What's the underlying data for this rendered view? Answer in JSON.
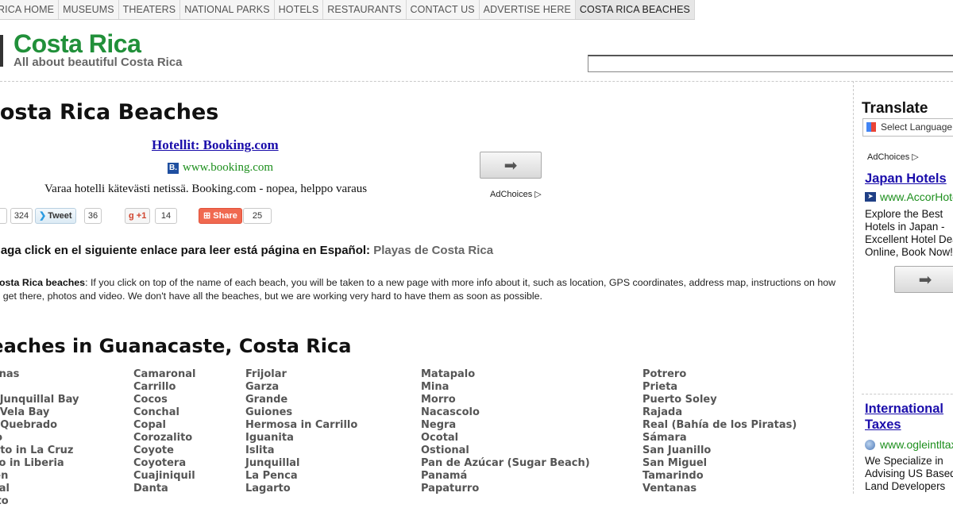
{
  "nav": {
    "items": [
      {
        "label": "RICA HOME"
      },
      {
        "label": "MUSEUMS"
      },
      {
        "label": "THEATERS"
      },
      {
        "label": "NATIONAL PARKS"
      },
      {
        "label": "HOTELS"
      },
      {
        "label": "RESTAURANTS"
      },
      {
        "label": "CONTACT US"
      },
      {
        "label": "ADVERTISE HERE"
      },
      {
        "label": "COSTA RICA BEACHES"
      }
    ]
  },
  "header": {
    "site_title": "Costa Rica",
    "tagline": "All about beautiful Costa Rica"
  },
  "page": {
    "title": "Costa Rica Beaches"
  },
  "ad": {
    "headline": "Hotellit: Booking.com",
    "icon_letter": "B.",
    "url": "www.booking.com",
    "description": "Varaa hotelli kätevästi netissä. Booking.com - nopea, helppo varaus",
    "go_glyph": "➡",
    "adchoices": "AdChoices ▷"
  },
  "social": {
    "like_count": "324",
    "tweet_label": "Tweet",
    "tweet_count": "36",
    "gplus_label": "+1",
    "gplus_count": "14",
    "share_label": "Share",
    "share_count": "25"
  },
  "spanish": {
    "prefix": "Haga click en el siguiente enlace para leer está página en Español:",
    "link": "Playas de Costa Rica"
  },
  "intro": {
    "bold": "Costa Rica beaches",
    "text": ": If you click on top of the name of each beach, you will be taken to a new page with more info about it, such as location, GPS coordinates, address map, instructions on how to get there, photos and video. We don't have all the beaches, but we are working very hard to have them as soon as possible."
  },
  "section": {
    "title": "Beaches in Guanacaste, Costa Rica"
  },
  "beaches": {
    "col1": [
      "Avellanas",
      "",
      "Bahía Junquillal Bay",
      "Bahía Vela Bay",
      "Barco Quebrado",
      "Blanco",
      "Brasilito in La Cruz",
      "Carrillo in Liberia",
      "Carmen",
      "Conchal",
      "Coquito"
    ],
    "col2": [
      "Camaronal",
      "Carrillo",
      "Cocos",
      "Conchal",
      "Copal",
      "Corozalito",
      "Coyote",
      "Coyotera",
      "Cuajiniquil",
      "Danta"
    ],
    "col3": [
      "Frijolar",
      "Garza",
      "Grande",
      "Guiones",
      "Hermosa in Carrillo",
      "Iguanita",
      "Islita",
      "Junquillal",
      "La Penca",
      "Lagarto"
    ],
    "col4": [
      "Matapalo",
      "Mina",
      "Morro",
      "Nacascolo",
      "Negra",
      "Ocotal",
      "Ostional",
      "Pan de Azúcar (Sugar Beach)",
      "Panamá",
      "Papaturro"
    ],
    "col5": [
      "Potrero",
      "Prieta",
      "Puerto Soley",
      "Rajada",
      "Real (Bahía de los Piratas)",
      "Sámara",
      "San Juanillo",
      "San Miguel",
      "Tamarindo",
      "Ventanas"
    ]
  },
  "sidebar": {
    "translate_title": "Translate",
    "select_language": "Select Language",
    "adchoices": "AdChoices ▷",
    "ad1": {
      "title": "Japan Hotels",
      "url": "www.AccorHotels.com",
      "description": "Explore the Best Hotels in Japan - Excellent Hotel Deals Online, Book Now!"
    },
    "go_glyph": "➡",
    "ad2": {
      "title_line1": "International",
      "title_line2": "Taxes",
      "url": "www.ogleintltax.com",
      "description": "We Specialize in Advising US Based Land Developers"
    }
  }
}
